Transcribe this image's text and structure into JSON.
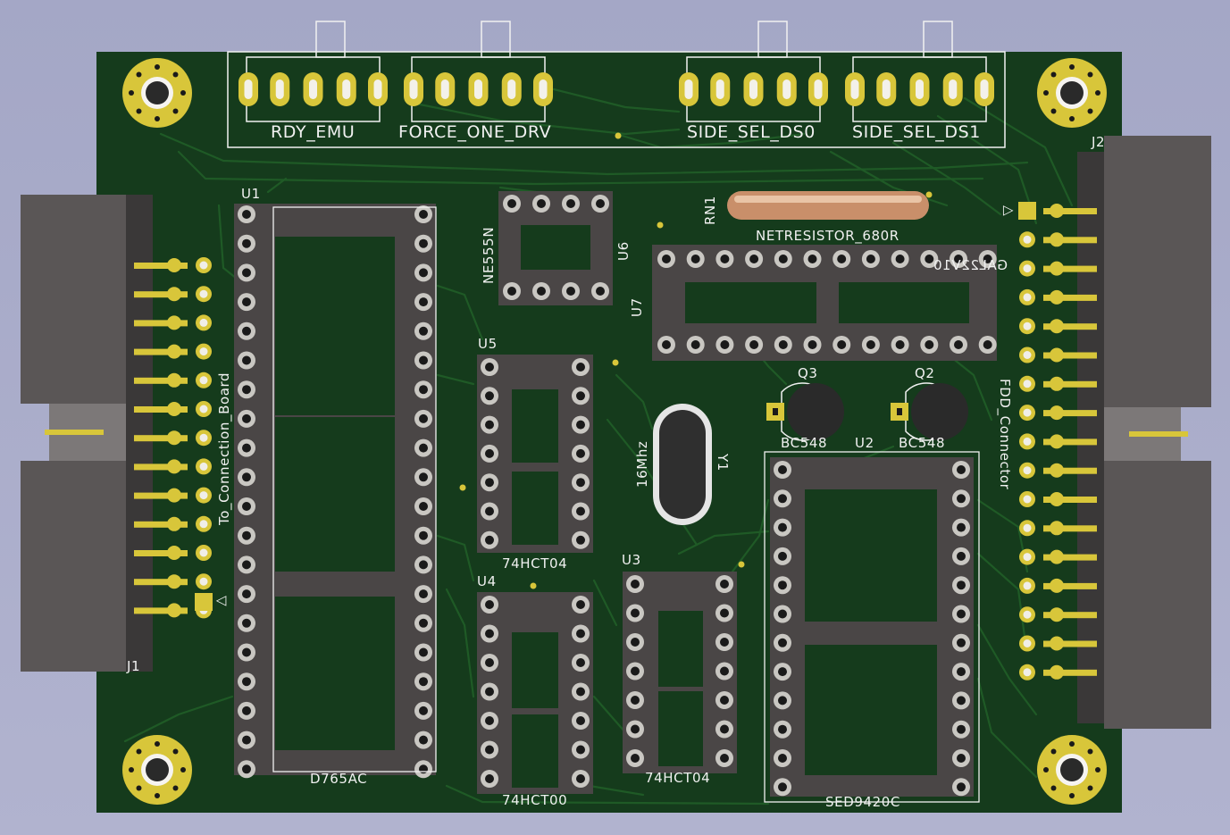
{
  "board": {
    "colors": {
      "soldermask": "#153b1c",
      "trace": "#1f5a26",
      "silkscreen": "#f1f1f1",
      "pad_gold": "#d8c63a",
      "socket_gray": "#4a4646",
      "background": "#a8aac8"
    }
  },
  "labels": {
    "rdy_emu": "RDY_EMU",
    "force_one_drv": "FORCE_ONE_DRV",
    "side_sel_ds0": "SIDE_SEL_DS0",
    "side_sel_ds1": "SIDE_SEL_DS1",
    "u1": "U1",
    "d765ac": "D765AC",
    "ne555n": "NE555N",
    "u6": "U6",
    "rn1": "RN1",
    "netresistor": "NETRESISTOR_680R",
    "u7": "U7",
    "gal22v10": "GAL22V10",
    "u5": "U5",
    "hct04_a": "74HCT04",
    "u4": "U4",
    "hct00": "74HCT00",
    "u3": "U3",
    "hct04_b": "74HCT04",
    "q3": "Q3",
    "q2": "Q2",
    "bc548_a": "BC548",
    "bc548_b": "BC548",
    "u2": "U2",
    "sed9420c": "SED9420C",
    "y1": "Y1",
    "freq": "16Mhz",
    "to_connection_board": "To_Connection_Board",
    "fdd_connector": "FDD_Connector",
    "j1": "J1",
    "j2": "J2",
    "pin1_left": "△",
    "pin1_right": "▽"
  }
}
